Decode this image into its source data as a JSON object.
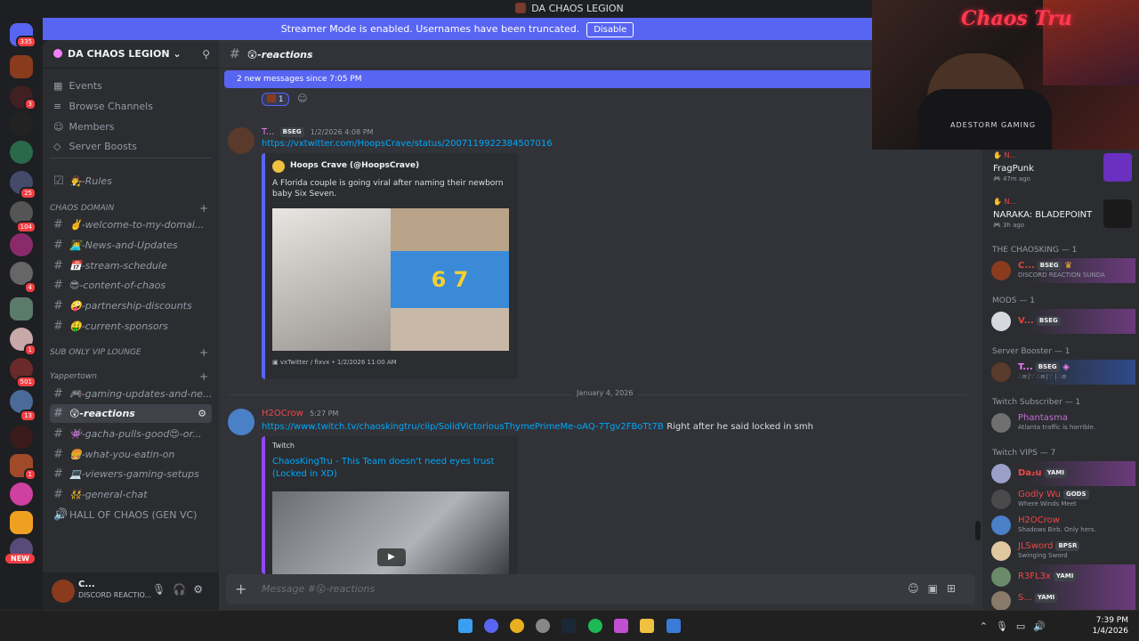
{
  "window": {
    "title": "DA CHAOS LEGION"
  },
  "streamer_banner": {
    "text": "Streamer Mode is enabled. Usernames have been truncated.",
    "button": "Disable"
  },
  "server_rail": {
    "badges": [
      "335",
      "3",
      "25",
      "104",
      "4",
      "1",
      "501",
      "13",
      "1"
    ],
    "new_label": "NEW"
  },
  "sidebar": {
    "guild_name": "DA CHAOS LEGION",
    "nav": [
      "Events",
      "Browse Channels",
      "Members",
      "Server Boosts"
    ],
    "rules_channel": "👨‍⚖️-Rules",
    "categories": [
      {
        "name": "CHAOS DOMAIN",
        "channels": [
          "✌️-welcome-to-my-domai...",
          "👨‍💻-News-and-Updates",
          "📅-stream-schedule",
          "😎-content-of-chaos",
          "🤪-partnership-discounts",
          "🤑-current-sponsors"
        ]
      },
      {
        "name": "SUB ONLY VIP LOUNGE",
        "channels": []
      },
      {
        "name": "Yappertown",
        "channels": [
          "🎮-gaming-updates-and-ne...",
          "😲-reactions",
          "👾-gacha-pulls-good😍-or...",
          "🍔-what-you-eatin-on",
          "💻-viewers-gaming-setups",
          "👯-general-chat"
        ]
      }
    ],
    "voice_channel": "HALL OF CHAOS (GEN VC)",
    "user": {
      "name": "C...",
      "status": "DISCORD REACTIO..."
    }
  },
  "chat": {
    "channel": "😲-reactions",
    "new_messages_bar": "2 new messages since 7:05 PM",
    "reaction_count": "1",
    "messages": [
      {
        "author": "T...",
        "tag": "BSEG",
        "time": "1/2/2026 4:08 PM",
        "link": "https://vxtwitter.com/HoopsCrave/status/2007119922384507016",
        "text": "",
        "embed": {
          "author": "Hoops Crave (@HoopsCrave)",
          "description": "A Florida couple is going viral after naming their newborn baby Six Seven.",
          "image_text": "6 7",
          "footer": "vxTwitter / fixvx • 1/2/2026 11:00 AM"
        }
      },
      {
        "author": "H2OCrow",
        "tag": "",
        "time": "5:27 PM",
        "link": "https://www.twitch.tv/chaoskingtru/clip/SolidVictoriousThymePrimeMe-oAQ-7Tgv2FBoTt7B",
        "text": "Right after he said locked in smh",
        "embed": {
          "provider": "Twitch",
          "title": "ChaosKingTru - This Team doesn't need eyes trust (Locked in XD)"
        }
      }
    ],
    "date_divider": "January 4, 2026",
    "composer_placeholder": "Message #😲-reactions"
  },
  "members": {
    "activities": [
      {
        "name": "N...",
        "game": "FragPunk",
        "time": "47m ago"
      },
      {
        "name": "N...",
        "game": "NARAKA: BLADEPOINT",
        "time": "3h ago"
      }
    ],
    "groups": [
      {
        "title": "THE CHAOSKING — 1",
        "members": [
          {
            "name": "C...",
            "tag": "BSEG",
            "status": "DISCORD REACTION SUNDA",
            "color": "#e0463a"
          }
        ]
      },
      {
        "title": "MODS — 1",
        "members": [
          {
            "name": "V...",
            "tag": "BSEG",
            "status": "",
            "color": "#e0463a"
          }
        ]
      },
      {
        "title": "Server Booster — 1",
        "members": [
          {
            "name": "T...",
            "tag": "BSEG",
            "status": "∴≡∣∵ ∴≡∣∵ ∣∴≡",
            "color": "#f47fff"
          }
        ]
      },
      {
        "title": "Twitch Subscriber — 1",
        "members": [
          {
            "name": "Phantasma",
            "tag": "",
            "status": "Atlanta traffic is horrible.",
            "color": "#c26fd1"
          }
        ]
      },
      {
        "title": "Twitch VIPS — 7",
        "members": [
          {
            "name": "Da₂u",
            "tag": "YAMI",
            "status": "",
            "color": "#f04747"
          },
          {
            "name": "Godly Wu",
            "tag": "GODS",
            "status": "Where Winds Meet",
            "color": "#f04747"
          },
          {
            "name": "H2OCrow",
            "tag": "",
            "status": "Shadows Birb. Only hers.",
            "color": "#f04747"
          },
          {
            "name": "JLSword",
            "tag": "BPSR",
            "status": "Swinging Sword",
            "color": "#f04747"
          },
          {
            "name": "R3FL3x",
            "tag": "YAMI",
            "status": "",
            "color": "#f04747"
          },
          {
            "name": "S...",
            "tag": "YAMI",
            "status": "",
            "color": "#f04747"
          }
        ]
      }
    ]
  },
  "webcam": {
    "neon_text": "Chaos Tru",
    "shirt_text": "ADESTORM GAMING"
  },
  "taskbar": {
    "time": "7:39 PM",
    "date": "1/4/2026"
  }
}
